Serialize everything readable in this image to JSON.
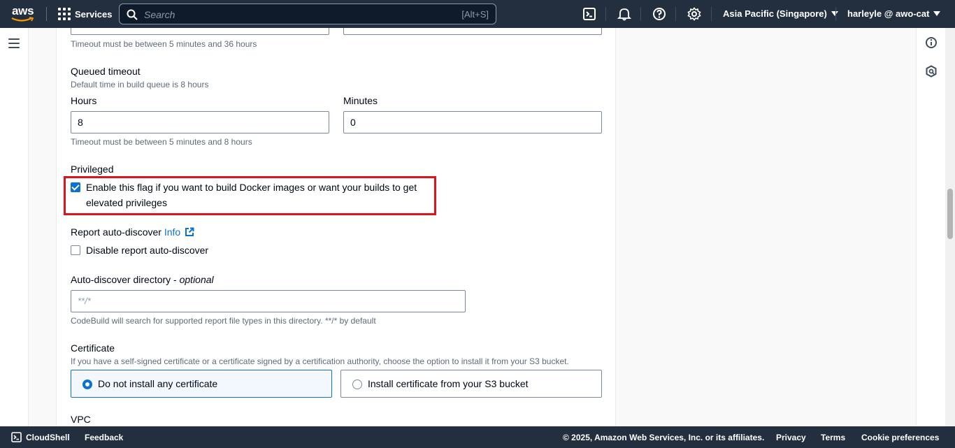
{
  "topnav": {
    "logo_text": "aws",
    "services_label": "Services",
    "search_placeholder": "Search",
    "search_shortcut": "[Alt+S]",
    "region": "Asia Pacific (Singapore)",
    "user": "harleyle @ awo-cat"
  },
  "form": {
    "timeout_desc": "Timeout must be between 5 minutes and 36 hours",
    "queued_timeout": {
      "label": "Queued timeout",
      "description": "Default time in build queue is 8 hours",
      "hours_label": "Hours",
      "hours_value": "8",
      "minutes_label": "Minutes",
      "minutes_value": "0",
      "constraint": "Timeout must be between 5 minutes and 8 hours"
    },
    "privileged": {
      "label": "Privileged",
      "checkbox_line1": "Enable this flag if you want to build Docker images or want your builds to get",
      "checkbox_line2": "elevated privileges",
      "checked": true
    },
    "report_auto_discover": {
      "label": "Report auto-discover",
      "info_link": "Info",
      "checkbox_label": "Disable report auto-discover",
      "checked": false
    },
    "auto_discover_directory": {
      "label": "Auto-discover directory - ",
      "label_optional": "optional",
      "placeholder": "**/*",
      "description": "CodeBuild will search for supported report file types in this directory. **/* by default"
    },
    "certificate": {
      "label": "Certificate",
      "description": "If you have a self-signed certificate or a certificate signed by a certification authority, choose the option to install it from your S3 bucket.",
      "option_none": "Do not install any certificate",
      "option_s3": "Install certificate from your S3 bucket",
      "selected": "option_none"
    },
    "vpc_label": "VPC"
  },
  "footer": {
    "cloudshell": "CloudShell",
    "feedback": "Feedback",
    "copyright": "© 2025, Amazon Web Services, Inc. or its affiliates.",
    "privacy": "Privacy",
    "terms": "Terms",
    "cookies": "Cookie preferences"
  },
  "colors": {
    "nav_bg": "#232f3e",
    "accent_blue": "#0972d3",
    "highlight_red": "#e0131a"
  }
}
